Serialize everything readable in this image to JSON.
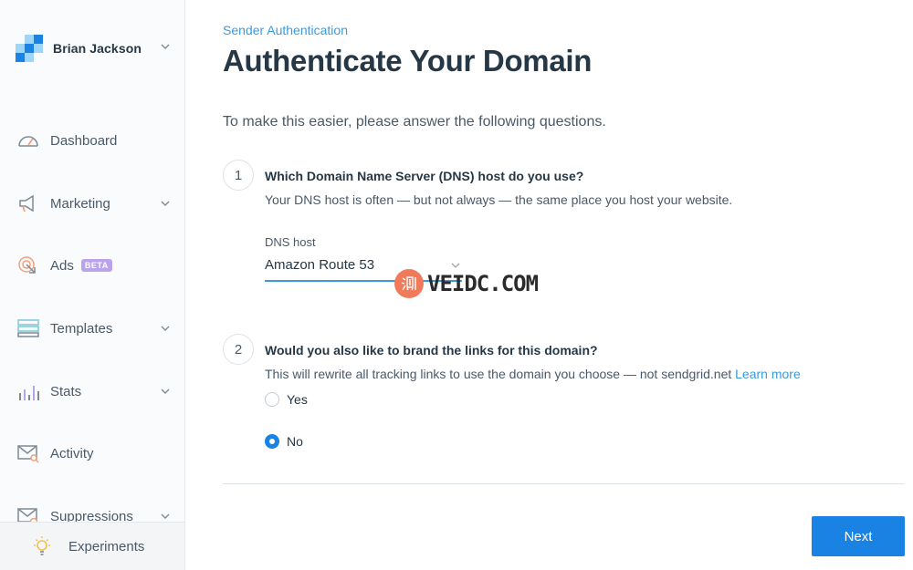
{
  "sidebar": {
    "user_name": "Brian Jackson",
    "items": [
      {
        "label": "Dashboard",
        "icon": "gauge-icon",
        "has_caret": false
      },
      {
        "label": "Marketing",
        "icon": "megaphone-icon",
        "has_caret": true
      },
      {
        "label": "Ads",
        "icon": "target-cursor-icon",
        "has_caret": false,
        "badge": "BETA"
      },
      {
        "label": "Templates",
        "icon": "template-icon",
        "has_caret": true
      },
      {
        "label": "Stats",
        "icon": "bar-chart-icon",
        "has_caret": true
      },
      {
        "label": "Activity",
        "icon": "mail-search-icon",
        "has_caret": false
      },
      {
        "label": "Suppressions",
        "icon": "mail-block-icon",
        "has_caret": true
      }
    ],
    "footer": {
      "label": "Experiments",
      "icon": "lightbulb-icon"
    }
  },
  "header": {
    "breadcrumb": "Sender Authentication",
    "title": "Authenticate Your Domain"
  },
  "intro": "To make this easier, please answer the following questions.",
  "questions": [
    {
      "number": "1",
      "title": "Which Domain Name Server (DNS) host do you use?",
      "help": "Your DNS host is often — but not always — the same place you host your website.",
      "field_label": "DNS host",
      "selected": "Amazon Route 53"
    },
    {
      "number": "2",
      "title": "Would you also like to brand the links for this domain?",
      "help": "This will rewrite all tracking links to use the domain you choose — not sendgrid.net",
      "help_link": "Learn more",
      "options": [
        {
          "label": "Yes",
          "checked": false
        },
        {
          "label": "No",
          "checked": true
        }
      ]
    }
  ],
  "next_label": "Next",
  "watermark": {
    "seal": "测",
    "text": "VEIDC.COM"
  },
  "colors": {
    "accent": "#1a82e2",
    "link": "#3a9bdc",
    "text": "#263746",
    "beta": "#b9a3ec"
  }
}
